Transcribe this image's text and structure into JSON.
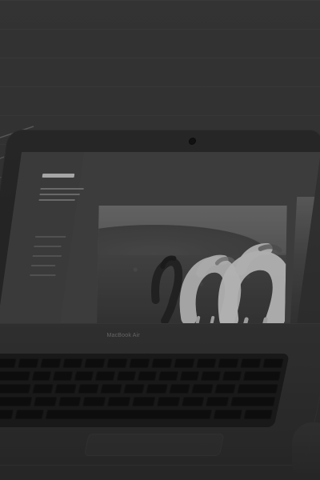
{
  "image": {
    "brand_text": "MacBook Air"
  }
}
